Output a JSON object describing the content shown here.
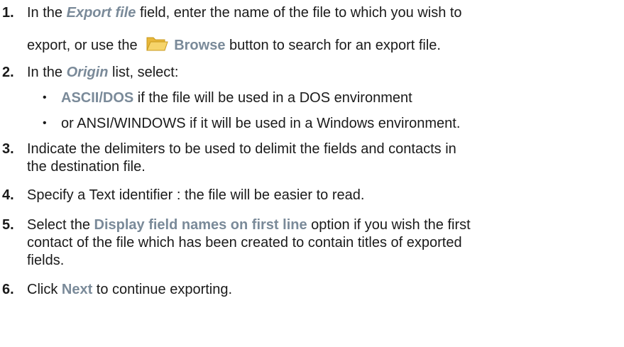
{
  "steps": [
    {
      "number": "1.",
      "line1_pre": "In the ",
      "line1_ref": "Export file",
      "line1_post": " field, enter the name of the file to which you wish to",
      "line2_pre": "export, or use the ",
      "line2_ref": "Browse",
      "line2_post": " button to search for an export file.",
      "icon": "folder-open-icon"
    },
    {
      "number": "2.",
      "line1_pre": "In the ",
      "line1_ref": "Origin",
      "line1_post": " list, select:",
      "bullets": [
        {
          "ref": "ASCII/DOS",
          "text": " if the file will be used in a DOS environment"
        },
        {
          "ref": "",
          "text": "or ANSI/WINDOWS if it will be used in a Windows environment."
        }
      ]
    },
    {
      "number": "3.",
      "line1": "Indicate the delimiters to be used to delimit the fields and contacts in",
      "line2": "the destination file."
    },
    {
      "number": "4.",
      "line1": "Specify a Text identifier : the file will be easier to read."
    },
    {
      "number": "5.",
      "line1_pre": "Select the ",
      "line1_ref": "Display field names on first line",
      "line1_post": " option if you wish the first",
      "line2": "contact of the file which has been created to contain titles of exported",
      "line3": "fields."
    },
    {
      "number": "6.",
      "line1_pre": "Click ",
      "line1_ref": "Next",
      "line1_post": " to continue exporting."
    }
  ],
  "colors": {
    "text": "#1a1a1a",
    "ui_reference": "#7a8a99",
    "folder_fill": "#f2c84b",
    "folder_edge": "#c99a1c"
  }
}
